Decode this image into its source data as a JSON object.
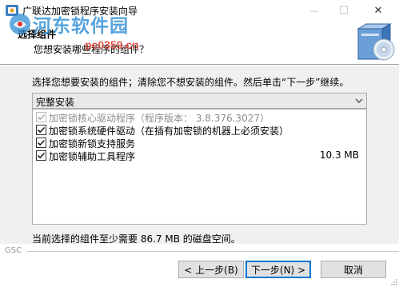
{
  "window": {
    "title": "广联达加密锁程序安装向导",
    "minimize_glyph": "—",
    "maximize_glyph": "☐",
    "close_glyph": "✕"
  },
  "watermark": {
    "text": "河东软件园",
    "url": "pc0359.cn"
  },
  "header": {
    "title": "选择组件",
    "subtitle": "您想安装哪些程序的组件？",
    "graphic_icon": "install-box-cd-icon"
  },
  "content": {
    "instruction": "选择您想要安装的组件；清除您不想安装的组件。然后单击“下一步”继续。",
    "install_type": {
      "selected": "完整安装"
    },
    "components": [
      {
        "label": "加密锁核心驱动程序（程序版本： 3.8.376.3027）",
        "checked": true,
        "disabled": true,
        "size": ""
      },
      {
        "label": "加密锁系统硬件驱动（在插有加密锁的机器上必须安装）",
        "checked": true,
        "disabled": false,
        "size": ""
      },
      {
        "label": "加密锁新锁支持服务",
        "checked": true,
        "disabled": false,
        "size": ""
      },
      {
        "label": "加密锁辅助工具程序",
        "checked": true,
        "disabled": false,
        "size": "10.3 MB"
      }
    ],
    "space_required": "当前选择的组件至少需要 86.7 MB 的磁盘空间。"
  },
  "footer": {
    "brand": "GSC",
    "back_label": "< 上一步(B)",
    "next_label": "下一步(N) >",
    "cancel_label": "取消"
  },
  "colors": {
    "accent": "#0078d7",
    "content_bg": "#f0f0f0",
    "watermark_blue": "#2d8ed6",
    "watermark_red": "#e03a2f"
  }
}
